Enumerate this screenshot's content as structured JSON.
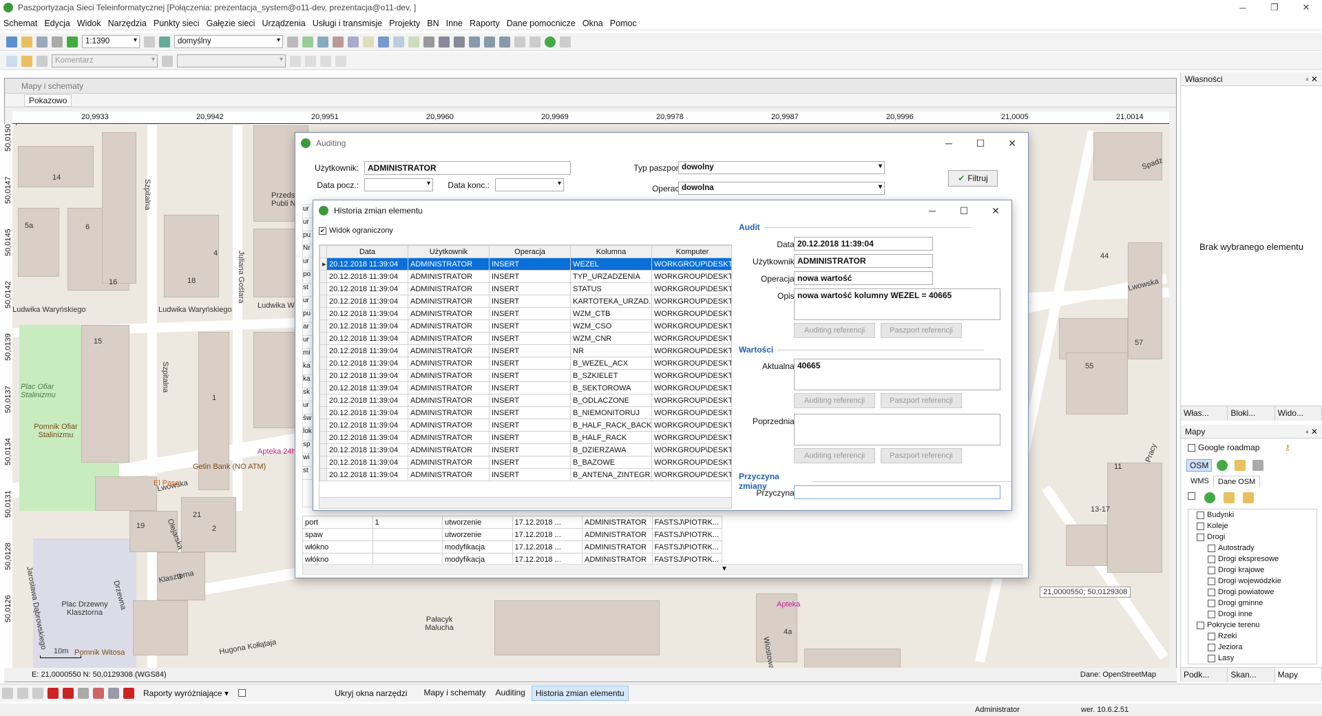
{
  "app": {
    "title": "Paszportyzacja Sieci Teleinformatycznej [Połączenia: prezentacja_system@o11-dev, prezentacja@o11-dev, ]"
  },
  "menu": [
    "Schemat",
    "Edycja",
    "Widok",
    "Narzędzia",
    "Punkty sieci",
    "Gałęzie sieci",
    "Urządzenia",
    "Usługi i transmisje",
    "Projekty",
    "BN",
    "Inne",
    "Raporty",
    "Dane pomocnicze",
    "Okna",
    "Pomoc"
  ],
  "toolbar": {
    "scale": "1:1390",
    "style": "domyślny",
    "comment_placeholder": "Komentarz"
  },
  "maps_window": {
    "title": "Mapy i schematy",
    "tab": "Pokazowo"
  },
  "ruler": {
    "top": [
      "20,9933",
      "20,9942",
      "20,9951",
      "20,9960",
      "20,9969",
      "20,9978",
      "20,9987",
      "20,9996",
      "21,0005",
      "21,0014"
    ],
    "left": [
      "50,0150",
      "50,0147",
      "50,0145",
      "50,0142",
      "50,0139",
      "50,0137",
      "50,0134",
      "50,0131",
      "50,0128",
      "50,0126"
    ]
  },
  "map_labels": {
    "street1": "Ludwika Waryńskiego",
    "street2": "Ludwika Waryńskiego",
    "street3": "Ludwika W",
    "street4": "Szpitalna",
    "street5": "Szpitalna",
    "street6": "Juliana Goślara",
    "street7": "Lwowska",
    "street8": "Lwowska",
    "street9": "Olejarska",
    "street10": "Klasztorna",
    "street11": "Drzewna",
    "street12": "Jarosława Dąbrowskiego",
    "street13": "Hugona Kołłątaja",
    "street14": "Pracy",
    "street15": "Spadz",
    "street16": "Wiostowa",
    "park": "Plac Ofiar Stalinizmu",
    "monument": "Pomnik Ofiar Stalinizmu",
    "square": "Plac Drzewny Klasztorna",
    "monument2": "Pomnik Witosa",
    "pharmacy": "Apteka 24h",
    "pharmacy2": "Apteka",
    "bank": "Getin Bank (NO ATM)",
    "elpaso": "El Paso",
    "palace": "Pałacyk Malucha",
    "school": "Przeds Publi Nr",
    "scale": "10m",
    "coord_tip": "21,0000550; 50,0129308",
    "n14": "14",
    "n5a": "5a",
    "n6": "6",
    "n16": "16",
    "n18": "18",
    "n4": "4",
    "n15": "15",
    "n1": "1",
    "n57": "57",
    "n55": "55",
    "n44": "44",
    "n15b": "15",
    "n2": "2",
    "n3": "3",
    "n19": "19",
    "n21": "21",
    "n4a": "4a",
    "n1317": "13-17",
    "n11": "11"
  },
  "map_status": {
    "coords": "E: 21,0000550  N: 50,0129308 (WGS84)",
    "source": "Dane: OpenStreetMap"
  },
  "auditing": {
    "title": "Auditing",
    "user_label": "Użytkownik:",
    "user_value": "ADMINISTRATOR",
    "start_label": "Data pocz.:",
    "end_label": "Data konc.:",
    "type_label": "Typ paszportu:",
    "type_value": "dowolny",
    "op_label": "Operacja:",
    "op_value": "dowolna",
    "filter_btn": "Filtruj",
    "left_col": [
      "ur",
      "ur",
      "pu",
      "Nr",
      "ur",
      "po",
      "st",
      "ur",
      "pu",
      "ar",
      "ur",
      "mi",
      "ka",
      "ka",
      "sk",
      "ur",
      "św",
      "lok",
      "sp",
      "wi",
      "st"
    ],
    "rows": [
      {
        "c1": "port",
        "c2": "1",
        "c3": "utworzenie",
        "c4": "17.12.2018 ...",
        "c5": "ADMINISTRATOR",
        "c6": "FASTSJ\\PIOTRK..."
      },
      {
        "c1": "spaw",
        "c2": "",
        "c3": "utworzenie",
        "c4": "17.12.2018 ...",
        "c5": "ADMINISTRATOR",
        "c6": "FASTSJ\\PIOTRK..."
      },
      {
        "c1": "włókno",
        "c2": "",
        "c3": "modyfikacja",
        "c4": "17.12.2018 ...",
        "c5": "ADMINISTRATOR",
        "c6": "FASTSJ\\PIOTRK..."
      },
      {
        "c1": "włókno",
        "c2": "",
        "c3": "modyfikacja",
        "c4": "17.12.2018 ...",
        "c5": "ADMINISTRATOR",
        "c6": "FASTSJ\\PIOTRK..."
      }
    ]
  },
  "historia": {
    "title": "Historia zmian elementu",
    "limited_view": "Widok ograniczony",
    "headers": [
      "Data",
      "Użytkownik",
      "Operacja",
      "Kolumna",
      "Komputer"
    ],
    "rows": [
      [
        "20.12.2018 11:39:04",
        "ADMINISTRATOR",
        "INSERT",
        "WEZEL",
        "WORKGROUP\\DESKT..."
      ],
      [
        "20.12.2018 11:39:04",
        "ADMINISTRATOR",
        "INSERT",
        "TYP_URZADZENIA",
        "WORKGROUP\\DESKT..."
      ],
      [
        "20.12.2018 11:39:04",
        "ADMINISTRATOR",
        "INSERT",
        "STATUS",
        "WORKGROUP\\DESKT..."
      ],
      [
        "20.12.2018 11:39:04",
        "ADMINISTRATOR",
        "INSERT",
        "KARTOTEKA_URZAD...",
        "WORKGROUP\\DESKT..."
      ],
      [
        "20.12.2018 11:39:04",
        "ADMINISTRATOR",
        "INSERT",
        "WZM_CTB",
        "WORKGROUP\\DESKT..."
      ],
      [
        "20.12.2018 11:39:04",
        "ADMINISTRATOR",
        "INSERT",
        "WZM_CSO",
        "WORKGROUP\\DESKT..."
      ],
      [
        "20.12.2018 11:39:04",
        "ADMINISTRATOR",
        "INSERT",
        "WZM_CNR",
        "WORKGROUP\\DESKT..."
      ],
      [
        "20.12.2018 11:39:04",
        "ADMINISTRATOR",
        "INSERT",
        "NR",
        "WORKGROUP\\DESKT..."
      ],
      [
        "20.12.2018 11:39:04",
        "ADMINISTRATOR",
        "INSERT",
        "B_WEZEL_ACX",
        "WORKGROUP\\DESKT..."
      ],
      [
        "20.12.2018 11:39:04",
        "ADMINISTRATOR",
        "INSERT",
        "B_SZKIELET",
        "WORKGROUP\\DESKT..."
      ],
      [
        "20.12.2018 11:39:04",
        "ADMINISTRATOR",
        "INSERT",
        "B_SEKTOROWA",
        "WORKGROUP\\DESKT..."
      ],
      [
        "20.12.2018 11:39:04",
        "ADMINISTRATOR",
        "INSERT",
        "B_ODLACZONE",
        "WORKGROUP\\DESKT..."
      ],
      [
        "20.12.2018 11:39:04",
        "ADMINISTRATOR",
        "INSERT",
        "B_NIEMONITORUJ",
        "WORKGROUP\\DESKT..."
      ],
      [
        "20.12.2018 11:39:04",
        "ADMINISTRATOR",
        "INSERT",
        "B_HALF_RACK_BACK",
        "WORKGROUP\\DESKT..."
      ],
      [
        "20.12.2018 11:39:04",
        "ADMINISTRATOR",
        "INSERT",
        "B_HALF_RACK",
        "WORKGROUP\\DESKT..."
      ],
      [
        "20.12.2018 11:39:04",
        "ADMINISTRATOR",
        "INSERT",
        "B_DZIERZAWA",
        "WORKGROUP\\DESKT..."
      ],
      [
        "20.12.2018 11:39:04",
        "ADMINISTRATOR",
        "INSERT",
        "B_BAZOWE",
        "WORKGROUP\\DESKT..."
      ],
      [
        "20.12.2018 11:39:04",
        "ADMINISTRATOR",
        "INSERT",
        "B_ANTENA_ZINTEGR...",
        "WORKGROUP\\DESKT..."
      ]
    ],
    "audit_section": "Audit",
    "date_label": "Data:",
    "date_value": "20.12.2018 11:39:04",
    "user_label": "Użytkownik:",
    "user_value": "ADMINISTRATOR",
    "op_label": "Operacja:",
    "op_value": "nowa wartość",
    "desc_label": "Opis:",
    "desc_value": "nowa wartość kolumny WEZEL = 40665",
    "btn_auditing": "Auditing referencji",
    "btn_passport": "Paszport referencji",
    "values_section": "Wartości",
    "current_label": "Aktualna:",
    "current_value": "40665",
    "previous_label": "Poprzednia:",
    "previous_value": "",
    "reason_section": "Przyczyna zmiany",
    "reason_label": "Przyczyna:",
    "reason_value": ""
  },
  "right": {
    "props_title": "Własności",
    "no_selection": "Brak wybranego elementu",
    "tabs": [
      "Włas...",
      "Bloki...",
      "Wido..."
    ],
    "maps_title": "Mapy",
    "google": "Google roadmap",
    "osm": "OSM",
    "wms_tab": "WMS",
    "osm_tab": "Dane OSM",
    "tree": [
      {
        "l": "Budynki",
        "d": 1
      },
      {
        "l": "Koleje",
        "d": 1
      },
      {
        "l": "Drogi",
        "d": 1
      },
      {
        "l": "Autostrady",
        "d": 2
      },
      {
        "l": "Drogi ekspresowe",
        "d": 2
      },
      {
        "l": "Drogi krajowe",
        "d": 2
      },
      {
        "l": "Drogi wojewódzkie",
        "d": 2
      },
      {
        "l": "Drogi powiatowe",
        "d": 2
      },
      {
        "l": "Drogi gminne",
        "d": 2
      },
      {
        "l": "Drogi inne",
        "d": 2
      },
      {
        "l": "Pokrycie terenu",
        "d": 1
      },
      {
        "l": "Rzeki",
        "d": 2
      },
      {
        "l": "Jeziora",
        "d": 2
      },
      {
        "l": "Lasy",
        "d": 2
      }
    ],
    "bottom_tabs": [
      "Podk...",
      "Skan...",
      "Mapy"
    ]
  },
  "bottom": {
    "reports": "Raporty wyróżniające",
    "hide": "Ukryj okna narzędzi",
    "tasks": [
      "Mapy i schematy",
      "Auditing",
      "Historia zmian elementu"
    ]
  },
  "status": {
    "user": "Administrator",
    "version": "wer. 10.6.2.51"
  }
}
